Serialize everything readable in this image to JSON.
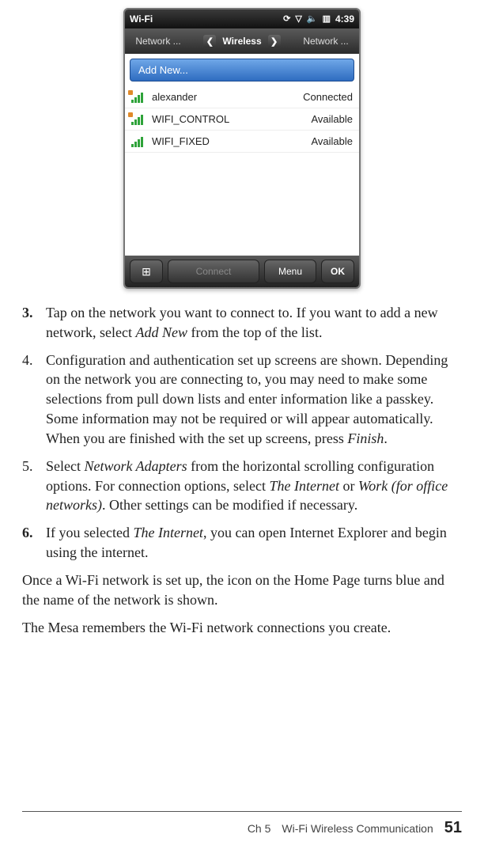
{
  "phone": {
    "status": {
      "app": "Wi-Fi",
      "time": "4:39"
    },
    "tabs": {
      "left": "Network ...",
      "center": "Wireless",
      "right": "Network ..."
    },
    "add_new": "Add New...",
    "networks": [
      {
        "name": "alexander",
        "status": "Connected",
        "secure": true,
        "strength": 4
      },
      {
        "name": "WIFI_CONTROL",
        "status": "Available",
        "secure": true,
        "strength": 4
      },
      {
        "name": "WIFI_FIXED",
        "status": "Available",
        "secure": false,
        "strength": 4
      }
    ],
    "bottom": {
      "connect": "Connect",
      "menu": "Menu",
      "ok": "OK"
    }
  },
  "steps": {
    "s3": {
      "num": "3.",
      "pre": "Tap on the network you want to connect to. If you want to add a new network, select ",
      "em": "Add New",
      "post": " from the top of the list."
    },
    "s4": {
      "num": "4.",
      "pre": "Configuration and authentication set up screens are shown. Depending on the network you are connecting to, you may need to make some selections from pull down lists and enter information like a passkey. Some information may not be required or will appear automatically. When you are finished with the set up screens, press ",
      "em": "Finish",
      "post": "."
    },
    "s5": {
      "num": "5.",
      "pre": "Select ",
      "em1": "Network Adapters",
      "mid": " from the horizontal scrolling configuration options. For connection options, select ",
      "em2": "The Internet",
      "mid2": " or ",
      "em3": "Work (for office networks)",
      "post": ". Other settings can be modified if necessary."
    },
    "s6": {
      "num": "6.",
      "pre": "If you selected ",
      "em": "The Internet",
      "post": ", you can open Internet Explorer and begin using the internet."
    }
  },
  "para1": "Once a Wi-Fi network is set up, the icon on the Home Page turns blue and the name of the network is shown.",
  "para2": "The Mesa remembers the Wi-Fi network connections you create.",
  "footer": {
    "chapter": "Ch 5",
    "title": "Wi-Fi Wireless Communication",
    "page": "51"
  }
}
